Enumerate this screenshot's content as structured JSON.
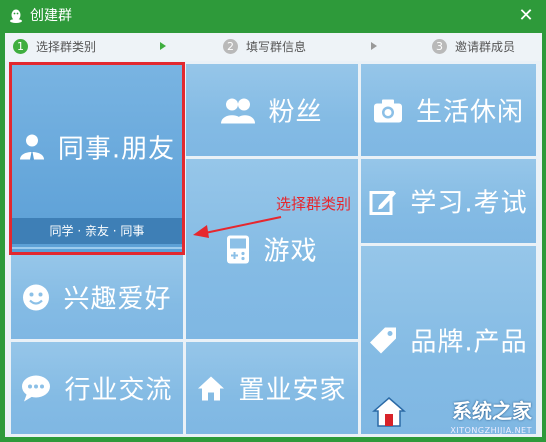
{
  "window": {
    "title": "创建群",
    "close_glyph": "✕"
  },
  "steps": [
    {
      "num": "1",
      "label": "选择群类别",
      "active": true
    },
    {
      "num": "2",
      "label": "填写群信息",
      "active": false
    },
    {
      "num": "3",
      "label": "邀请群成员",
      "active": false
    }
  ],
  "tiles": {
    "coworkers": {
      "label": "同事.朋友",
      "sub": "同学 · 亲友 · 同事",
      "icon": "person-icon",
      "selected": true
    },
    "fans": {
      "label": "粉丝",
      "icon": "people-icon"
    },
    "leisure": {
      "label": "生活休闲",
      "icon": "camera-icon"
    },
    "games": {
      "label": "游戏",
      "icon": "gamepad-icon"
    },
    "study": {
      "label": "学习.考试",
      "icon": "pencil-note-icon"
    },
    "hobby": {
      "label": "兴趣爱好",
      "icon": "smiley-icon"
    },
    "brand": {
      "label": "品牌.产品",
      "icon": "tag-icon"
    },
    "industry": {
      "label": "行业交流",
      "icon": "chat-bubble-icon"
    },
    "realestate": {
      "label": "置业安家",
      "icon": "house-icon"
    }
  },
  "annotation": {
    "text": "选择群类别",
    "color": "#e6272e"
  },
  "watermark": {
    "text": "系统之家",
    "url": "XITONGZHIJIA.NET"
  },
  "colors": {
    "title_bar": "#2e9a3a",
    "tile": "#8cc0e7",
    "tile_selected": "#5b9fd6",
    "sub_bar": "#3e7fb6",
    "highlight": "#e2282f",
    "step_active": "#3fae3f"
  }
}
